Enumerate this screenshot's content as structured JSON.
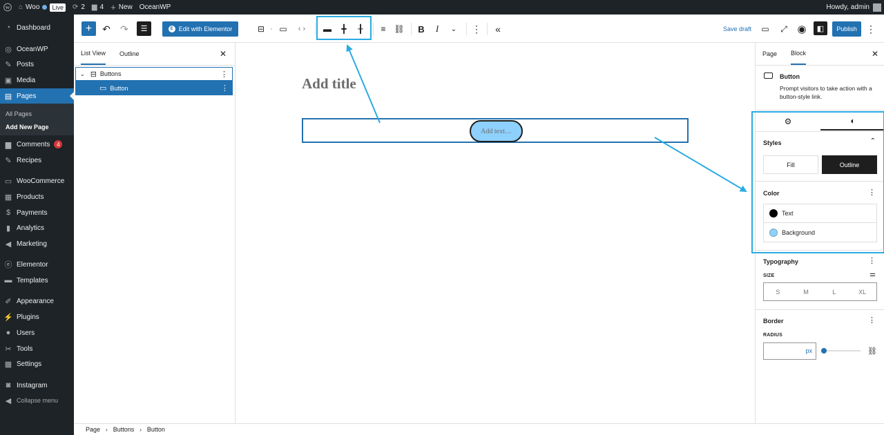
{
  "adminbar": {
    "site_name": "Woo",
    "live_label": "Live",
    "updates_count": "2",
    "comments_count": "4",
    "new_label": "New",
    "theme_label": "OceanWP",
    "greeting": "Howdy, admin"
  },
  "sidebar": {
    "items": [
      {
        "label": "Dashboard",
        "icon": "dashboard-icon"
      },
      {
        "label": "OceanWP",
        "icon": "oceanwp-icon"
      },
      {
        "label": "Posts",
        "icon": "pin-icon"
      },
      {
        "label": "Media",
        "icon": "media-icon"
      },
      {
        "label": "Pages",
        "icon": "page-icon"
      },
      {
        "label": "Comments",
        "icon": "comment-icon",
        "badge": "4"
      },
      {
        "label": "Recipes",
        "icon": "pin-icon"
      },
      {
        "label": "WooCommerce",
        "icon": "woo-icon"
      },
      {
        "label": "Products",
        "icon": "archive-icon"
      },
      {
        "label": "Payments",
        "icon": "dollar-icon"
      },
      {
        "label": "Analytics",
        "icon": "chart-icon"
      },
      {
        "label": "Marketing",
        "icon": "megaphone-icon"
      },
      {
        "label": "Elementor",
        "icon": "elementor-icon"
      },
      {
        "label": "Templates",
        "icon": "folder-icon"
      },
      {
        "label": "Appearance",
        "icon": "brush-icon"
      },
      {
        "label": "Plugins",
        "icon": "plugin-icon"
      },
      {
        "label": "Users",
        "icon": "user-icon"
      },
      {
        "label": "Tools",
        "icon": "wrench-icon"
      },
      {
        "label": "Settings",
        "icon": "settings-icon"
      },
      {
        "label": "Instagram",
        "icon": "instagram-icon"
      },
      {
        "label": "Collapse menu",
        "icon": "collapse-icon"
      }
    ],
    "pages_sub": [
      "All Pages",
      "Add New Page"
    ]
  },
  "toolbar": {
    "elementor_label": "Edit with Elementor",
    "save_draft": "Save draft",
    "publish": "Publish"
  },
  "left_panel": {
    "tabs": [
      "List View",
      "Outline"
    ],
    "tree": [
      "Buttons",
      "Button"
    ]
  },
  "canvas": {
    "title_placeholder": "Add title",
    "button_placeholder": "Add text…"
  },
  "right_panel": {
    "tabs": [
      "Page",
      "Block"
    ],
    "block_name": "Button",
    "block_desc": "Prompt visitors to take action with a button-style link.",
    "styles_heading": "Styles",
    "styles": [
      "Fill",
      "Outline"
    ],
    "active_style": "Outline",
    "color_heading": "Color",
    "colors": [
      {
        "label": "Text",
        "value": "#000000"
      },
      {
        "label": "Background",
        "value": "#8ed1fc"
      }
    ],
    "typography_heading": "Typography",
    "size_label": "SIZE",
    "sizes": [
      "S",
      "M",
      "L",
      "XL"
    ],
    "border_heading": "Border",
    "radius_label": "RADIUS",
    "radius_unit": "px"
  },
  "breadcrumb": [
    "Page",
    "Buttons",
    "Button"
  ],
  "colors": {
    "accent": "#2271b1",
    "highlight": "#29abe2",
    "admin_dark": "#1d2327"
  }
}
